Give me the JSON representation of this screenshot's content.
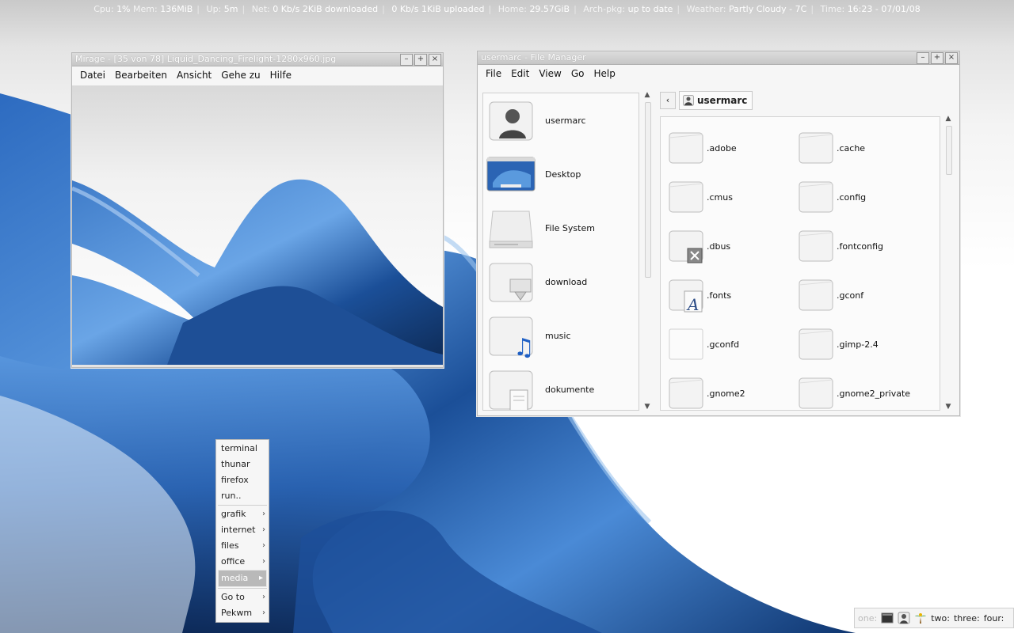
{
  "statusbar": {
    "cpu_label": "Cpu:",
    "cpu_value": "1%",
    "mem_label": "Mem:",
    "mem_value": "136MiB",
    "up_label": "Up:",
    "up_value": "5m",
    "net_label": "Net:",
    "net_down": "0 Kb/s",
    "downloaded": "2KiB downloaded",
    "net_up": "0 Kb/s",
    "uploaded": "1KiB uploaded",
    "home_label": "Home:",
    "home_value": "29.57GiB",
    "archpkg_label": "Arch-pkg:",
    "archpkg_value": "up to date",
    "weather_label": "Weather:",
    "weather_value": "Partly Cloudy - 7C",
    "time_label": "Time:",
    "time_value": "16:23 - 07/01/08"
  },
  "mirage": {
    "title": "Mirage - [35 von 78] Liquid_Dancing_Firelight-1280x960.jpg",
    "menu": [
      "Datei",
      "Bearbeiten",
      "Ansicht",
      "Gehe zu",
      "Hilfe"
    ]
  },
  "file_manager": {
    "title": "usermarc - File Manager",
    "menu": [
      "File",
      "Edit",
      "View",
      "Go",
      "Help"
    ],
    "places": [
      {
        "label": "usermarc",
        "icon": "user-home-icon"
      },
      {
        "label": "Desktop",
        "icon": "desktop-icon"
      },
      {
        "label": "File System",
        "icon": "harddisk-icon"
      },
      {
        "label": "download",
        "icon": "download-folder-icon"
      },
      {
        "label": "music",
        "icon": "music-folder-icon"
      },
      {
        "label": "dokumente",
        "icon": "documents-folder-icon"
      }
    ],
    "path": "usermarc",
    "files": [
      {
        "name": ".adobe",
        "icon": "folder-icon"
      },
      {
        "name": ".cache",
        "icon": "folder-icon"
      },
      {
        "name": ".cmus",
        "icon": "folder-icon"
      },
      {
        "name": ".config",
        "icon": "folder-icon"
      },
      {
        "name": ".dbus",
        "icon": "folder-locked-icon"
      },
      {
        "name": ".fontconfig",
        "icon": "folder-icon"
      },
      {
        "name": ".fonts",
        "icon": "folder-fonts-icon"
      },
      {
        "name": ".gconf",
        "icon": "folder-icon"
      },
      {
        "name": ".gconfd",
        "icon": "folder-open-icon"
      },
      {
        "name": ".gimp-2.4",
        "icon": "folder-icon"
      },
      {
        "name": ".gnome2",
        "icon": "folder-icon"
      },
      {
        "name": ".gnome2_private",
        "icon": "folder-icon"
      }
    ]
  },
  "root_menu": {
    "items": [
      {
        "label": "terminal",
        "submenu": false
      },
      {
        "label": "thunar",
        "submenu": false
      },
      {
        "label": "firefox",
        "submenu": false
      },
      {
        "label": "run..",
        "submenu": false
      },
      {
        "label": "grafik",
        "submenu": true
      },
      {
        "label": "internet",
        "submenu": true
      },
      {
        "label": "files",
        "submenu": true
      },
      {
        "label": "office",
        "submenu": true
      },
      {
        "label": "media",
        "submenu": true,
        "selected": true
      },
      {
        "label": "Go to",
        "submenu": true
      },
      {
        "label": "Pekwm",
        "submenu": true
      }
    ]
  },
  "pager": {
    "workspaces": [
      "one:",
      "two:",
      "three:",
      "four:"
    ],
    "current": "one:",
    "task_icons": [
      "terminal-icon",
      "file-manager-icon",
      "palm-tree-icon"
    ]
  },
  "colors": {
    "ribbon_blue": "#3f7cc9",
    "ribbon_dark": "#0d2a55",
    "window_bg": "#f6f6f6",
    "selection": "#b9b9b9"
  }
}
